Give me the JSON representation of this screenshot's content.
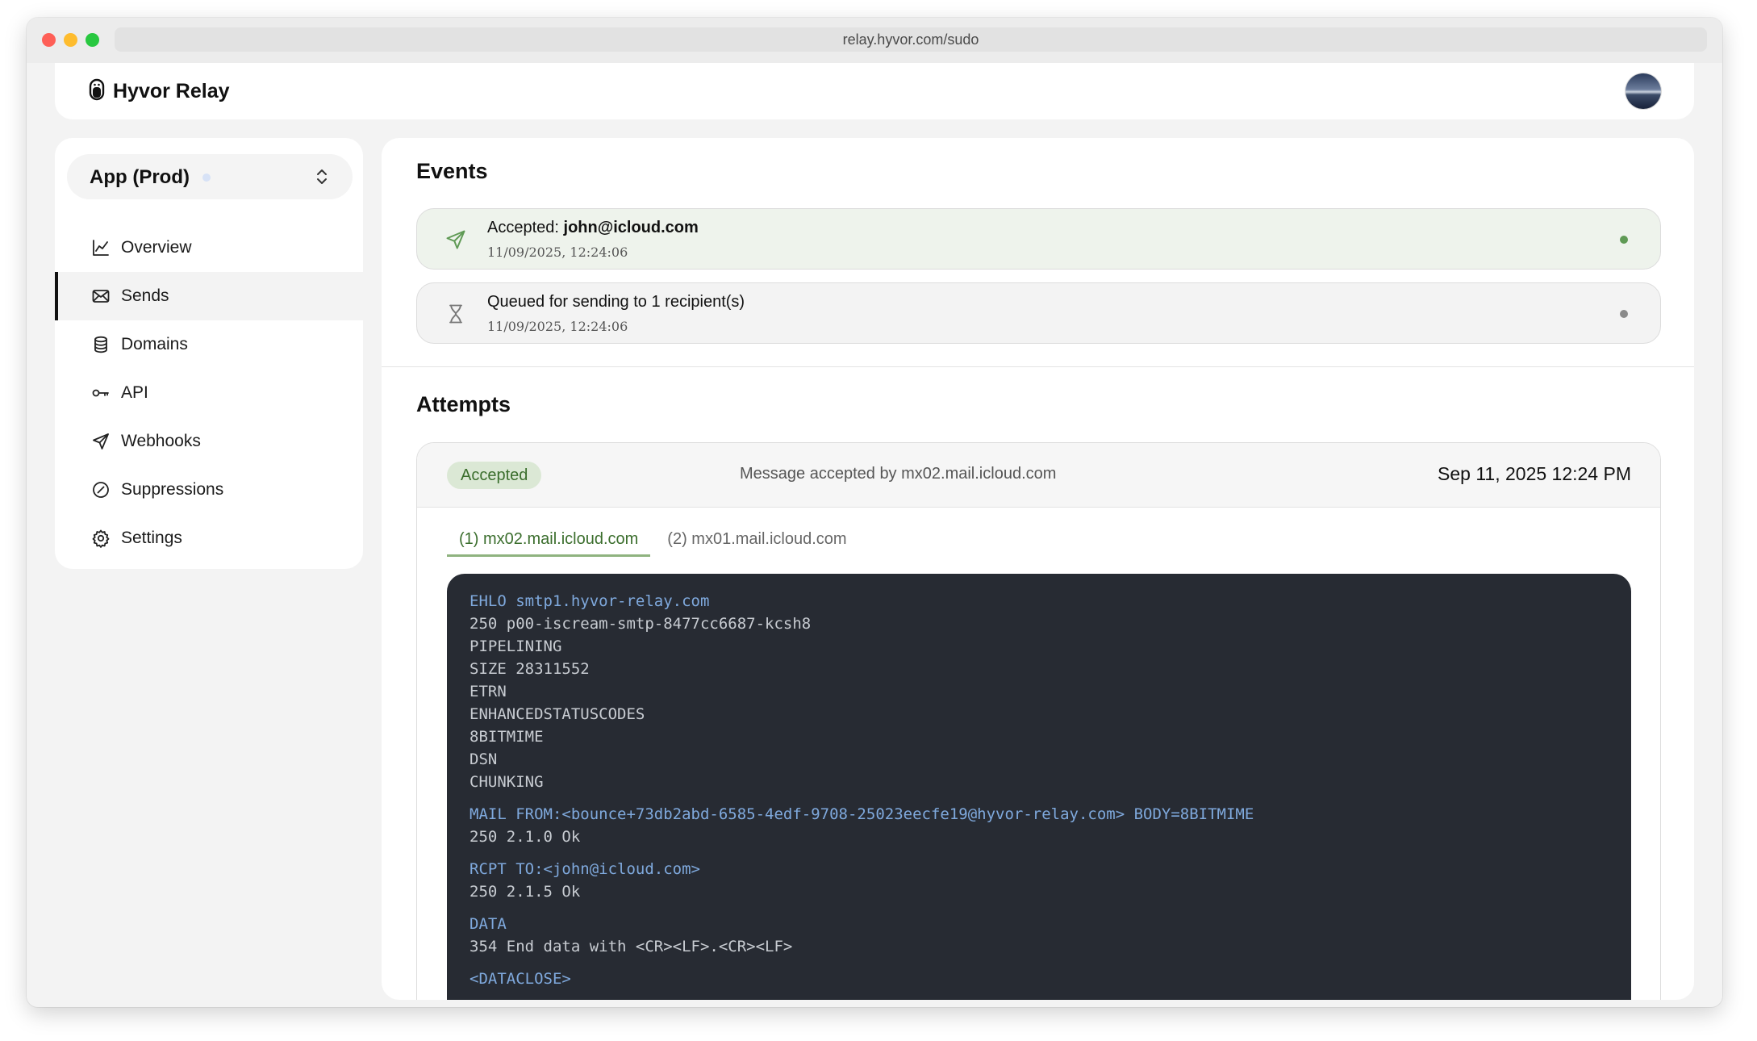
{
  "browser": {
    "url": "relay.hyvor.com/sudo"
  },
  "header": {
    "app_name": "Hyvor Relay"
  },
  "sidebar": {
    "project_name": "App (Prod)",
    "items": [
      {
        "label": "Overview",
        "icon": "chart-line-icon"
      },
      {
        "label": "Sends",
        "icon": "envelope-icon"
      },
      {
        "label": "Domains",
        "icon": "database-icon"
      },
      {
        "label": "API",
        "icon": "key-icon"
      },
      {
        "label": "Webhooks",
        "icon": "send-icon"
      },
      {
        "label": "Suppressions",
        "icon": "slash-circle-icon"
      },
      {
        "label": "Settings",
        "icon": "gear-icon"
      }
    ],
    "active_item": "Sends"
  },
  "events": {
    "title": "Events",
    "items": [
      {
        "prefix": "Accepted: ",
        "recipient": "john@icloud.com",
        "time": "11/09/2025, 12:24:06",
        "icon": "send-icon",
        "dot_color": "#5f9a55"
      },
      {
        "text": "Queued for sending to 1 recipient(s)",
        "time": "11/09/2025, 12:24:06",
        "icon": "hourglass-icon",
        "dot_color": "#8a8a8a"
      }
    ]
  },
  "attempts": {
    "title": "Attempts",
    "status": "Accepted",
    "message": "Message accepted by mx02.mail.icloud.com",
    "date": "Sep 11, 2025 12:24 PM",
    "tabs": [
      "(1) mx02.mail.icloud.com",
      "(2) mx01.mail.icloud.com"
    ],
    "active_tab": 0,
    "log": [
      {
        "command": "EHLO smtp1.hyvor-relay.com",
        "responses": [
          "250 p00-iscream-smtp-8477cc6687-kcsh8",
          "PIPELINING",
          "SIZE 28311552",
          "ETRN",
          "ENHANCEDSTATUSCODES",
          "8BITMIME",
          "DSN",
          "CHUNKING"
        ]
      },
      {
        "command": "MAIL FROM:<bounce+73db2abd-6585-4edf-9708-25023eecfe19@hyvor-relay.com> BODY=8BITMIME",
        "responses": [
          "250 2.1.0 Ok"
        ]
      },
      {
        "command": "RCPT TO:<john@icloud.com>",
        "responses": [
          "250 2.1.5 Ok"
        ]
      },
      {
        "command": "DATA",
        "responses": [
          "354 End data with <CR><LF>.<CR><LF>"
        ]
      },
      {
        "command": "<DATACLOSE>",
        "responses": []
      }
    ]
  },
  "colors": {
    "accent_green": "#3b6e2d",
    "badge_bg": "#dbe8d5",
    "code_bg": "#272b33",
    "code_command": "#7fa9dd"
  }
}
